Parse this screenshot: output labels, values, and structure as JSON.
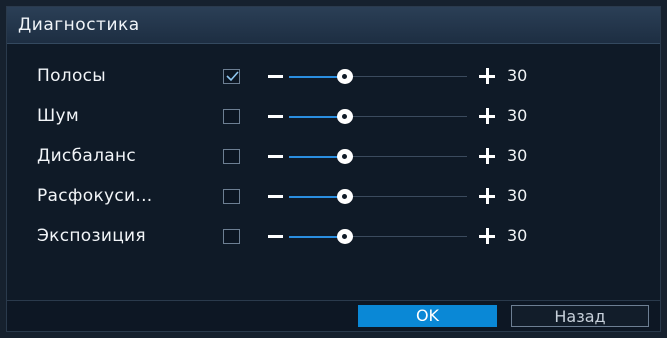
{
  "dialog": {
    "title": "Диагностика"
  },
  "rows": [
    {
      "label": "Полосы",
      "checked": true,
      "value": "30"
    },
    {
      "label": "Шум",
      "checked": false,
      "value": "30"
    },
    {
      "label": "Дисбаланс",
      "checked": false,
      "value": "30"
    },
    {
      "label": "Расфокуси...",
      "checked": false,
      "value": "30"
    },
    {
      "label": "Экспозиция",
      "checked": false,
      "value": "30"
    }
  ],
  "footer": {
    "ok_label": "OK",
    "back_label": "Назад"
  },
  "icons": {
    "check": "checkmark-icon",
    "minus": "minus-icon",
    "plus": "plus-icon"
  },
  "colors": {
    "accent": "#0a88d6",
    "slider_fill": "#2a8ee0"
  }
}
